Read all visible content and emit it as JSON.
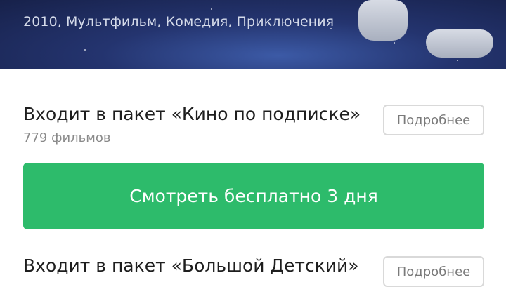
{
  "hero": {
    "meta": "2010, Мультфильм, Комедия, Приключения"
  },
  "packages": [
    {
      "title": "Входит в пакет «Кино по подписке»",
      "count": "779 фильмов",
      "more_label": "Подробнее"
    },
    {
      "title": "Входит в пакет «Большой Детский»",
      "more_label": "Подробнее"
    }
  ],
  "watch_button": {
    "label": "Смотреть бесплатно 3 дня"
  },
  "colors": {
    "accent_green": "#2dbb6b",
    "hero_navy": "#1f2c5c"
  }
}
